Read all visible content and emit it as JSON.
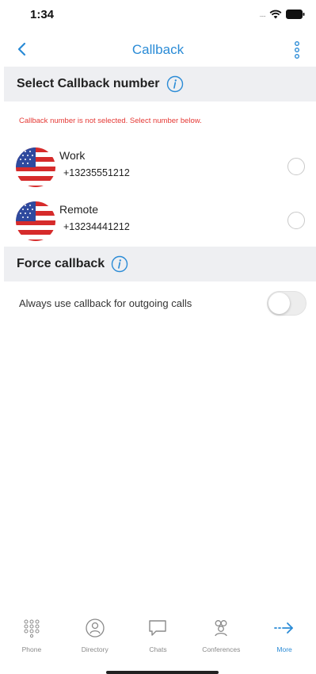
{
  "status": {
    "time": "1:34",
    "signal": "....."
  },
  "nav": {
    "title": "Callback"
  },
  "callback_section": {
    "title": "Select Callback number",
    "warning": "Callback number is not selected. Select number below.",
    "numbers": [
      {
        "label": "Work",
        "number": "+13235551212",
        "flag": "us-flag-icon",
        "selected": false
      },
      {
        "label": "Remote",
        "number": "+13234441212",
        "flag": "us-flag-icon",
        "selected": false
      }
    ]
  },
  "force_section": {
    "title": "Force callback",
    "toggle_label": "Always use callback for outgoing calls",
    "toggle_on": false
  },
  "tabs": [
    {
      "label": "Phone",
      "icon": "dialpad-icon",
      "active": false
    },
    {
      "label": "Directory",
      "icon": "directory-icon",
      "active": false
    },
    {
      "label": "Chats",
      "icon": "chat-bubble-icon",
      "active": false
    },
    {
      "label": "Conferences",
      "icon": "conference-icon",
      "active": false
    },
    {
      "label": "More",
      "icon": "arrow-right-icon",
      "active": true
    }
  ],
  "colors": {
    "accent": "#2a8bd6",
    "warning": "#e53935",
    "section_bg": "#eeeff2"
  }
}
